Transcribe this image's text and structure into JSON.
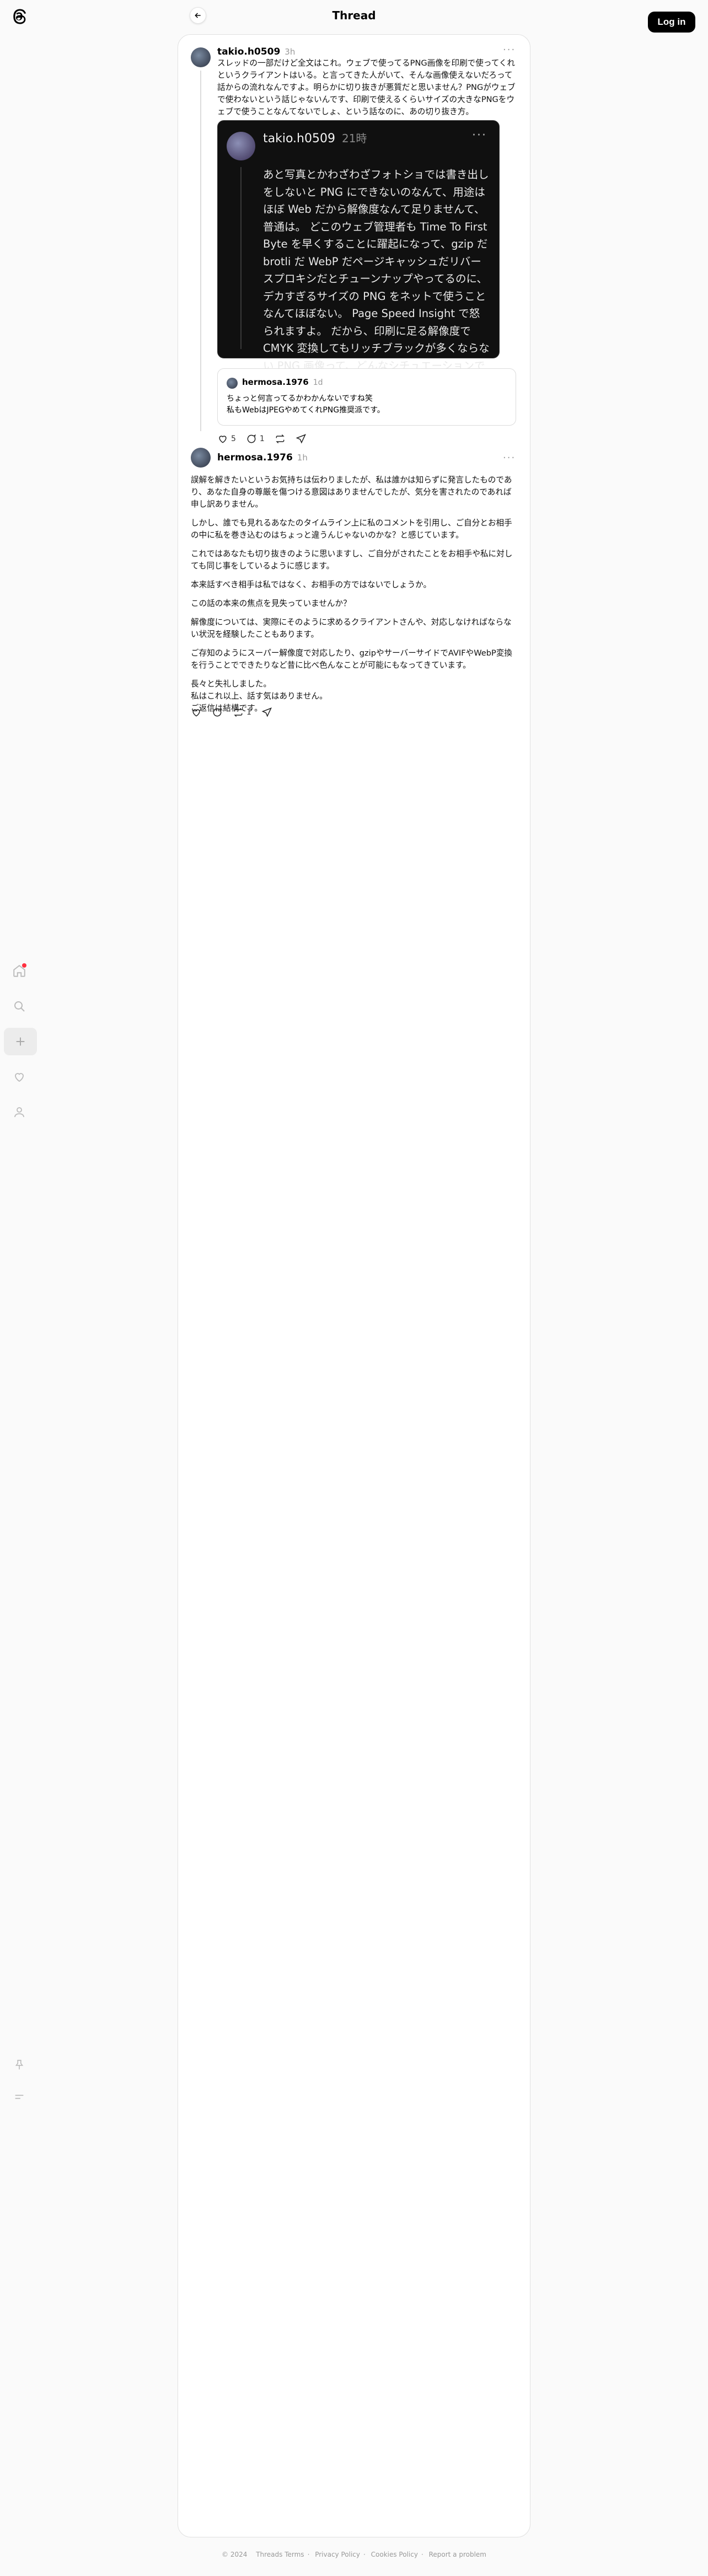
{
  "header": {
    "title": "Thread",
    "login_label": "Log in"
  },
  "post1": {
    "username": "takio.h0509",
    "time": "3h",
    "text": "スレッドの一部だけど全文はこれ。ウェブで使ってるPNG画像を印刷で使ってくれというクライアントはいる。と言ってきた人がいて、そんな画像使えないだろって話からの流れなんですよ。明らかに切り抜きが悪質だと思いません？PNGがウェブで使わないという話じゃないんです、印刷で使えるくらいサイズの大きなPNGをウェブで使うことなんてないでしょ、という話なのに、あの切り抜き方。",
    "quote": {
      "username": "takio.h0509",
      "time": "21時",
      "text": "あと写真とかわざわざフォトショでは書き出しをしないと PNG にできないのなんて、用途はほぼ Web だから解像度なんて足りませんて、普通は。 どこのウェブ管理者も Time To First Byte を早くすることに躍起になって、gzip だ brotli だ WebP だページキャッシュだリバースプロキシだとチューンナップやってるのに、デカすぎるサイズの PNG をネットで使うことなんてほぼない。 Page Speed Insight で怒られますよ。 だから、印刷に足る解像度で CMYK 変換してもリッチブラックが多くならない PNG 画像って、どんなシチュエーションで作られたもの？と聞いてたんだけど。"
    },
    "quote2": {
      "username": "hermosa.1976",
      "time": "1d",
      "line1": "ちょっと何言ってるかわかんないですね笑",
      "line2": "私もWebはJPEGやめてくれPNG推奨派です。"
    },
    "likes": "5",
    "replies": "1"
  },
  "post2": {
    "username": "hermosa.1976",
    "time": "1h",
    "paragraphs": [
      "誤解を解きたいというお気持ちは伝わりましたが、私は誰かは知らずに発言したものであり、あなた自身の尊厳を傷つける意図はありませんでしたが、気分を害されたのであれば申し訳ありません。",
      "しかし、誰でも見れるあなたのタイムライン上に私のコメントを引用し、ご自分とお相手の中に私を巻き込むのはちょっと違うんじゃないのかな？と感じています。",
      "これではあなたも切り抜きのように思いますし、ご自分がされたことをお相手や私に対しても同じ事をしているように感じます。",
      "本来話すべき相手は私ではなく、お相手の方ではないでしょうか。",
      "この話の本来の焦点を見失っていませんか？",
      "解像度については、実際にそのように求めるクライアントさんや、対応しなければならない状況を経験したこともあります。",
      "ご存知のようにスーパー解像度で対応したり、gzipやサーバーサイドでAVIFやWebP変換を行うことでできたりなど昔に比べ色んなことが可能にもなってきています。",
      "長々と失礼しました。\n私はこれ以上、話す気はありません。\nご返信は結構です。"
    ],
    "replies": "1"
  },
  "footer": {
    "copyright": "© 2024",
    "links": [
      "Threads Terms",
      "Privacy Policy",
      "Cookies Policy",
      "Report a problem"
    ]
  }
}
